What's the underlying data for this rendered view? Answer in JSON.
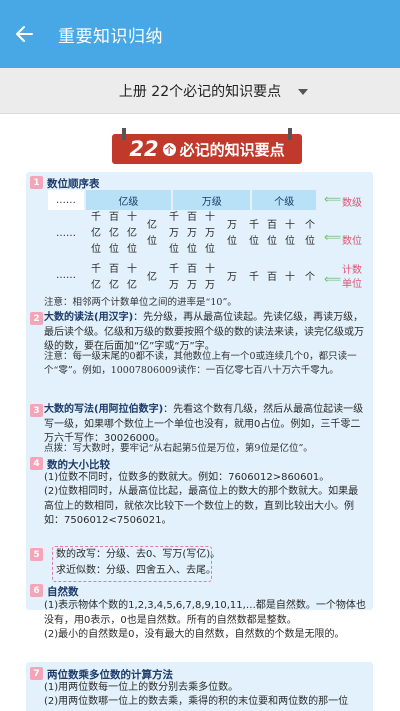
{
  "appbar": {
    "title": "重要知识归纳",
    "back_icon": "back-arrow-icon"
  },
  "selector": {
    "value": "上册 22个必记的知识要点"
  },
  "banner": {
    "num": "22",
    "circle": "个",
    "title": "必记的知识要点"
  },
  "sections": {
    "s1": {
      "num": "1",
      "title": "数位顺序表"
    },
    "s2": {
      "num": "2",
      "title": "大数的读法(用汉字)",
      "text": "：先分级，再从最高位读起。先读亿级，再读万级，最后读个级。亿级和万级的数要按照个级的数的读法来读，读完亿级或万级的数，要在后面加“亿”字或“万”字。",
      "note": "注意：每一级末尾的0都不读，其他数位上有一个0或连续几个0，都只读一个“零”。例如，10007806009读作：一百亿零七百八十万六千零九。"
    },
    "s3": {
      "num": "3",
      "title": "大数的写法(用阿拉伯数字)",
      "text": "：先看这个数有几级，然后从最高位起读一级写一级，如果哪个数位上一个单位也没有，就用0占位。例如，三千零二万六千写作：30026000。",
      "note": "点拨：写大数时，要牢记“从右起第5位是万位，第9位是亿位”。"
    },
    "s4": {
      "num": "4",
      "title": "数的大小比较",
      "text1": "(1)位数不同时，位数多的数就大。例如：7606012>860601。",
      "text2": "(2)位数相同时，从最高位比起，最高位上的数大的那个数就大。如果最高位上的数相同，就依次比较下一个数位上的数，直到比较出大小。例如：7506012<7506021。"
    },
    "s5": {
      "num": "5",
      "line1": "数的改写：分级、去0、写万(写亿)。",
      "line2": "求近似数：分级、四舍五入、去尾。"
    },
    "s6": {
      "num": "6",
      "title": "自然数",
      "text1": "(1)表示物体个数的1,2,3,4,5,6,7,8,9,10,11,…都是自然数。一个物体也没有，用0表示，0也是自然数。所有的自然数都是整数。",
      "text2": "(2)最小的自然数是0，没有最大的自然数，自然数的个数是无限的。"
    },
    "s7": {
      "num": "7",
      "title": "两位数乘多位数的计算方法",
      "text1": "(1)用两位数每一位上的数分别去乘多位数。",
      "text2": "(2)用两位数哪一位上的数去乘，乘得的积的末位要和两位数的那一位"
    }
  },
  "table": {
    "dots": "……",
    "levels": [
      "亿级",
      "万级",
      "个级"
    ],
    "side_level": "数级",
    "side_position": "数位",
    "side_unit": "计数单位",
    "positions": [
      [
        "千",
        "亿",
        "位"
      ],
      [
        "百",
        "亿",
        "位"
      ],
      [
        "十",
        "亿",
        "位"
      ],
      [
        "亿",
        "位",
        ""
      ],
      [
        "千",
        "万",
        "位"
      ],
      [
        "百",
        "万",
        "位"
      ],
      [
        "十",
        "万",
        "位"
      ],
      [
        "万",
        "位",
        ""
      ],
      [
        "千",
        "位",
        ""
      ],
      [
        "百",
        "位",
        ""
      ],
      [
        "十",
        "位",
        ""
      ],
      [
        "个",
        "位",
        ""
      ]
    ],
    "units": [
      [
        "千",
        "亿"
      ],
      [
        "百",
        "亿"
      ],
      [
        "十",
        "亿"
      ],
      [
        "亿",
        ""
      ],
      [
        "千",
        "万"
      ],
      [
        "百",
        "万"
      ],
      [
        "十",
        "万"
      ],
      [
        "万",
        ""
      ],
      [
        "千",
        ""
      ],
      [
        "百",
        ""
      ],
      [
        "十",
        ""
      ],
      [
        "个",
        ""
      ]
    ],
    "note": "注意：相邻两个计数单位之间的进率是“10”。"
  },
  "colors": {
    "appbar": "#48a8e6",
    "banner": "#c0392b",
    "card": "#e2f1fb",
    "accent": "#e05475"
  }
}
